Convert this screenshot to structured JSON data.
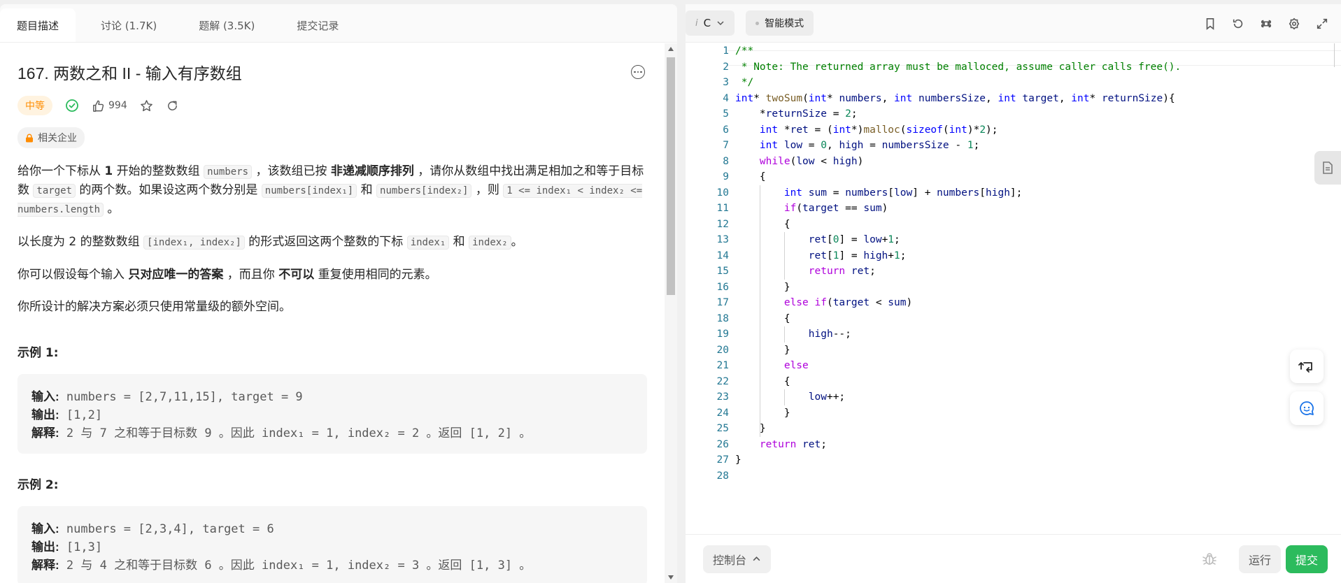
{
  "tabs": [
    {
      "label": "题目描述"
    },
    {
      "label": "讨论 (1.7K)"
    },
    {
      "label": "题解 (3.5K)"
    },
    {
      "label": "提交记录"
    }
  ],
  "problem": {
    "title": "167. 两数之和 II - 输入有序数组",
    "difficulty": "中等",
    "likes": "994",
    "company_label": "相关企业"
  },
  "description": {
    "p1_a": "给你一个下标从 ",
    "p1_b": "1",
    "p1_c": " 开始的整数数组 ",
    "p1_code1": "numbers",
    "p1_d": " ，该数组已按 ",
    "p1_e": "非递减顺序排列",
    "p1_f": " ，请你从数组中找出满足相加之和等于目标数 ",
    "p1_code2": "target",
    "p1_g": " 的两个数。如果设这两个数分别是 ",
    "p1_code3": "numbers[index₁]",
    "p1_h": " 和 ",
    "p1_code4": "numbers[index₂]",
    "p1_i": " ，则 ",
    "p1_code5": "1 <= index₁ < index₂ <= numbers.length",
    "p1_j": " 。",
    "p2_a": "以长度为 2 的整数数组 ",
    "p2_code1": "[index₁, index₂]",
    "p2_b": " 的形式返回这两个整数的下标 ",
    "p2_code2": "index₁",
    "p2_c": " 和 ",
    "p2_code3": "index₂",
    "p2_d": "。",
    "p3_a": "你可以假设每个输入 ",
    "p3_b": "只对应唯一的答案",
    "p3_c": " ，而且你 ",
    "p3_d": "不可以",
    "p3_e": " 重复使用相同的元素。",
    "p4": "你所设计的解决方案必须只使用常量级的额外空间。"
  },
  "examples": [
    {
      "title": "示例 1:",
      "input_label": "输入:",
      "input": " numbers = [2,7,11,15], target = 9",
      "output_label": "输出:",
      "output": " [1,2]",
      "explain_label": "解释:",
      "explain": " 2 与 7 之和等于目标数 9 。因此 index₁ = 1, index₂ = 2 。返回 [1, 2] 。"
    },
    {
      "title": "示例 2:",
      "input_label": "输入:",
      "input": " numbers = [2,3,4], target = 6",
      "output_label": "输出:",
      "output": " [1,3]",
      "explain_label": "解释:",
      "explain": " 2 与 4 之和等于目标数 6 。因此 index₁ = 1, index₂ = 3 。返回 [1, 3] 。"
    }
  ],
  "editor": {
    "language": "C",
    "language_prefix": "i",
    "mode": "智能模式",
    "console": "控制台",
    "run": "运行",
    "submit": "提交"
  },
  "code_lines": [
    "/**",
    " * Note: The returned array must be malloced, assume caller calls free().",
    " */",
    "int* twoSum(int* numbers, int numbersSize, int target, int* returnSize){",
    "    *returnSize = 2;",
    "    int *ret = (int*)malloc(sizeof(int)*2);",
    "    int low = 0, high = numbersSize - 1;",
    "    while(low < high)",
    "    {",
    "        int sum = numbers[low] + numbers[high];",
    "        if(target == sum)",
    "        {",
    "            ret[0] = low+1;",
    "            ret[1] = high+1;",
    "            return ret;",
    "        }",
    "        else if(target < sum)",
    "        {",
    "            high--;",
    "        }",
    "        else",
    "        {",
    "            low++;",
    "        }",
    "    }",
    "    return ret;",
    "}",
    ""
  ],
  "colors": {
    "difficulty_bg": "#fff3e0",
    "difficulty_fg": "#ff8c00",
    "accepted": "#2cbb5d",
    "submit_bg": "#2cbb5d",
    "line_number": "#237893",
    "comment": "#008000",
    "keyword": "#0000ff",
    "control": "#af00db"
  }
}
